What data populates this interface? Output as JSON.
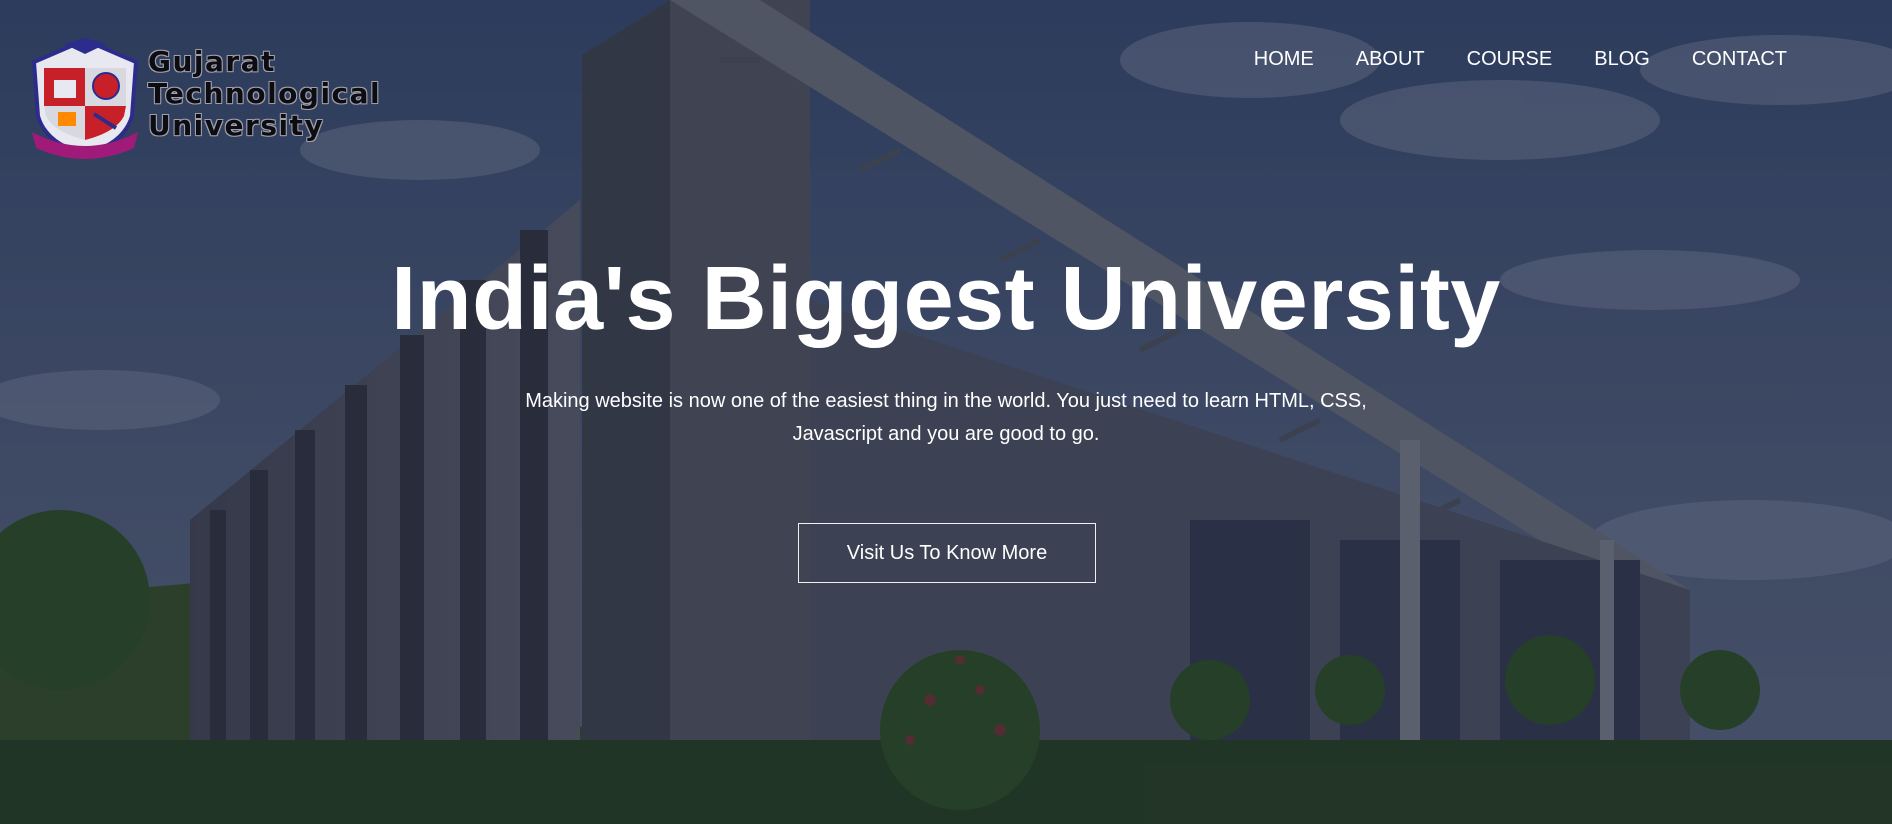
{
  "brand": {
    "name_lines": [
      "Gujarat",
      "Technological",
      "University"
    ],
    "logo_icon": "gtu-emblem-icon",
    "colors": {
      "emblem_red": "#d0202a",
      "emblem_blue": "#2c2c8c",
      "ribbon": "#a01a7a"
    }
  },
  "nav": {
    "items": [
      {
        "label": "HOME"
      },
      {
        "label": "ABOUT"
      },
      {
        "label": "COURSE"
      },
      {
        "label": "BLOG"
      },
      {
        "label": "CONTACT"
      }
    ]
  },
  "hero": {
    "title": "India's Biggest University",
    "subtitle": "Making website is now one of the easiest thing in the world. You just need to learn HTML, CSS, Javascript and you are good to go.",
    "cta_label": "Visit Us To Know More"
  },
  "colors": {
    "text": "#ffffff",
    "overlay": "#0e1428"
  }
}
